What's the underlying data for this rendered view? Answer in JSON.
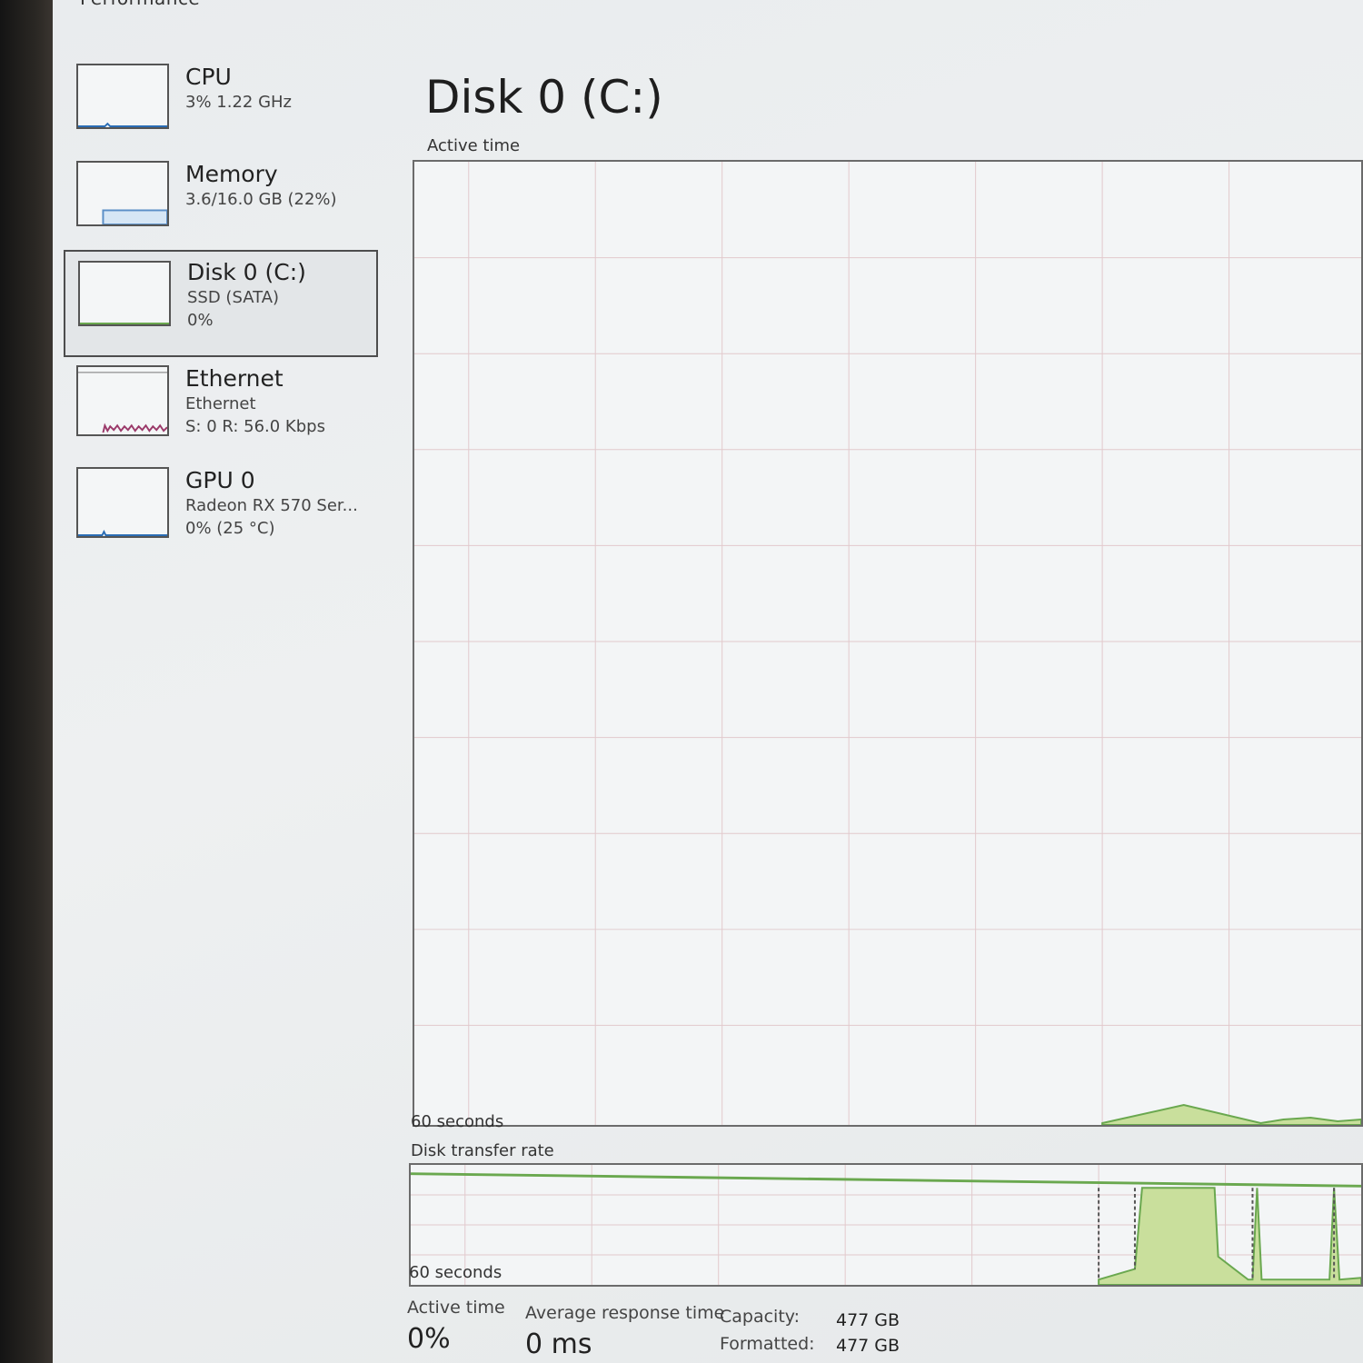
{
  "header": {
    "section_title": "Performance"
  },
  "sidebar": {
    "items": [
      {
        "name": "CPU",
        "lines": [
          "3% 1.22 GHz"
        ],
        "line_color": "#2a6db5",
        "level": 0.03
      },
      {
        "name": "Memory",
        "lines": [
          "3.6/16.0 GB (22%)"
        ],
        "line_color": "#5b8fc7",
        "level": 0.22
      },
      {
        "name": "Disk 0 (C:)",
        "lines": [
          "SSD (SATA)",
          "0%"
        ],
        "line_color": "#6aa84f",
        "level": 0.0
      },
      {
        "name": "Ethernet",
        "lines": [
          "Ethernet",
          "S: 0 R: 56.0 Kbps"
        ],
        "line_color": "#9b3a6a",
        "level": 0.05
      },
      {
        "name": "GPU 0",
        "lines": [
          "Radeon RX 570 Ser...",
          "0% (25 °C)"
        ],
        "line_color": "#2a6db5",
        "level": 0.0
      }
    ]
  },
  "main": {
    "title": "Disk 0 (C:)",
    "active_time_graph": {
      "label": "Active time",
      "time_label": "60 seconds"
    },
    "transfer_rate_graph": {
      "label": "Disk transfer rate",
      "time_label": "60 seconds"
    },
    "stats": [
      {
        "label": "Active time",
        "value": "0%"
      },
      {
        "label": "Average response time",
        "value": "0 ms"
      }
    ],
    "info": [
      {
        "label": "Capacity:",
        "value": "477 GB"
      },
      {
        "label": "Formatted:",
        "value": "477 GB"
      }
    ]
  },
  "colors": {
    "disk_line": "#6aa84f",
    "disk_fill": "#c9df9c",
    "grid": "#e2c9cc"
  }
}
